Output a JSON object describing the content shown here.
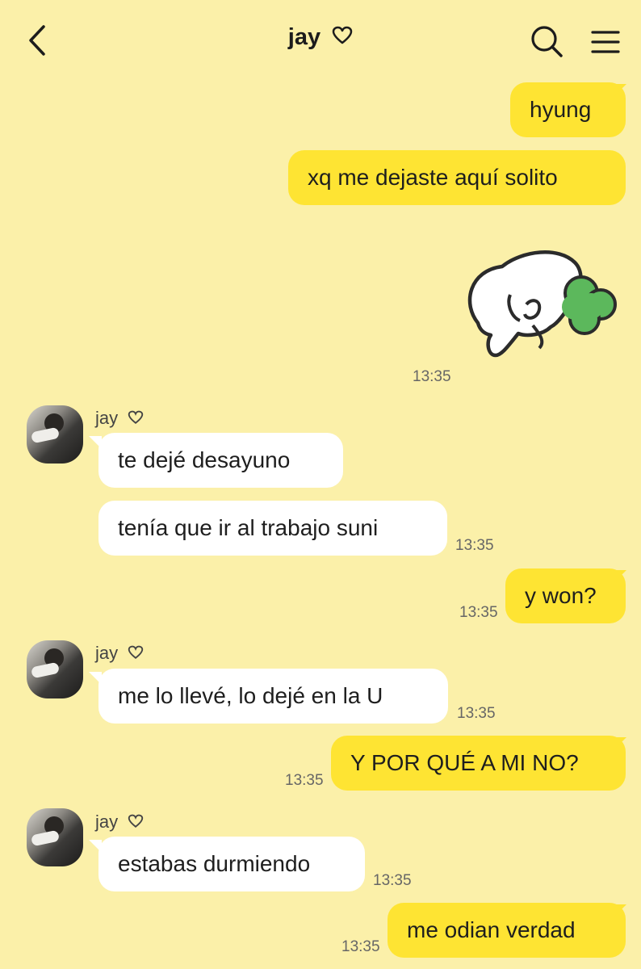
{
  "header": {
    "title": "jay",
    "back_icon": "chevron-left-icon",
    "search_icon": "search-icon",
    "menu_icon": "hamburger-menu-icon"
  },
  "colors": {
    "background": "#FBF0A9",
    "my_bubble": "#FEE433",
    "their_bubble": "#FFFFFF",
    "sticker_leaf": "#5CB85C"
  },
  "messages": {
    "m1": {
      "text": "hyung"
    },
    "m2": {
      "text": "xq me dejaste aquí solito"
    },
    "sticker": {
      "icon": "sleeping-bunny-sticker",
      "time": "13:35"
    },
    "g1": {
      "sender": "jay",
      "m1": "te dejé desayuno",
      "m2": "tenía que ir al trabajo suni",
      "time": "13:35"
    },
    "m3": {
      "text": "y won?",
      "time": "13:35"
    },
    "g2": {
      "sender": "jay",
      "m1": "me lo llevé, lo dejé en la U",
      "time": "13:35"
    },
    "m4": {
      "text": "Y POR QUÉ A MI NO?",
      "time": "13:35"
    },
    "g3": {
      "sender": "jay",
      "m1": "estabas durmiendo",
      "time": "13:35"
    },
    "m5": {
      "text": "me odian verdad",
      "time": "13:35"
    }
  }
}
